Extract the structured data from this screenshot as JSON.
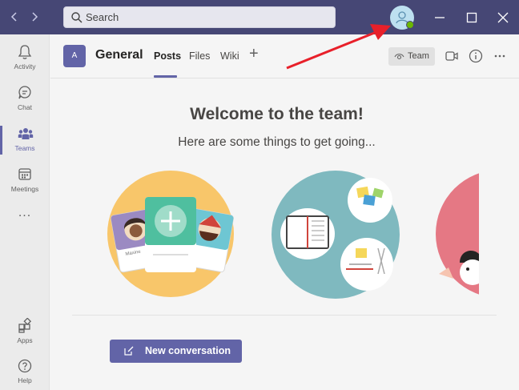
{
  "titlebar": {
    "search_placeholder": "Search"
  },
  "rail": {
    "items": [
      {
        "label": "Activity",
        "icon": "bell-icon"
      },
      {
        "label": "Chat",
        "icon": "chat-icon"
      },
      {
        "label": "Teams",
        "icon": "teams-icon",
        "active": true
      },
      {
        "label": "Meetings",
        "icon": "calendar-icon"
      },
      {
        "label": "Apps",
        "icon": "apps-icon"
      },
      {
        "label": "Help",
        "icon": "help-icon"
      }
    ],
    "more": "..."
  },
  "header": {
    "team_initial": "A",
    "channel": "General",
    "tabs": [
      "Posts",
      "Files",
      "Wiki"
    ],
    "add_tab": "+",
    "team_button": "Team"
  },
  "main": {
    "welcome": "Welcome to the team!",
    "subtitle": "Here are some things to get going...",
    "new_conversation": "New conversation"
  },
  "cards": {
    "left_name": "Maxine"
  },
  "colors": {
    "titlebar": "#464775",
    "accent": "#6264a7",
    "presence": "#6bb700",
    "annotation_arrow": "#e8202a"
  }
}
